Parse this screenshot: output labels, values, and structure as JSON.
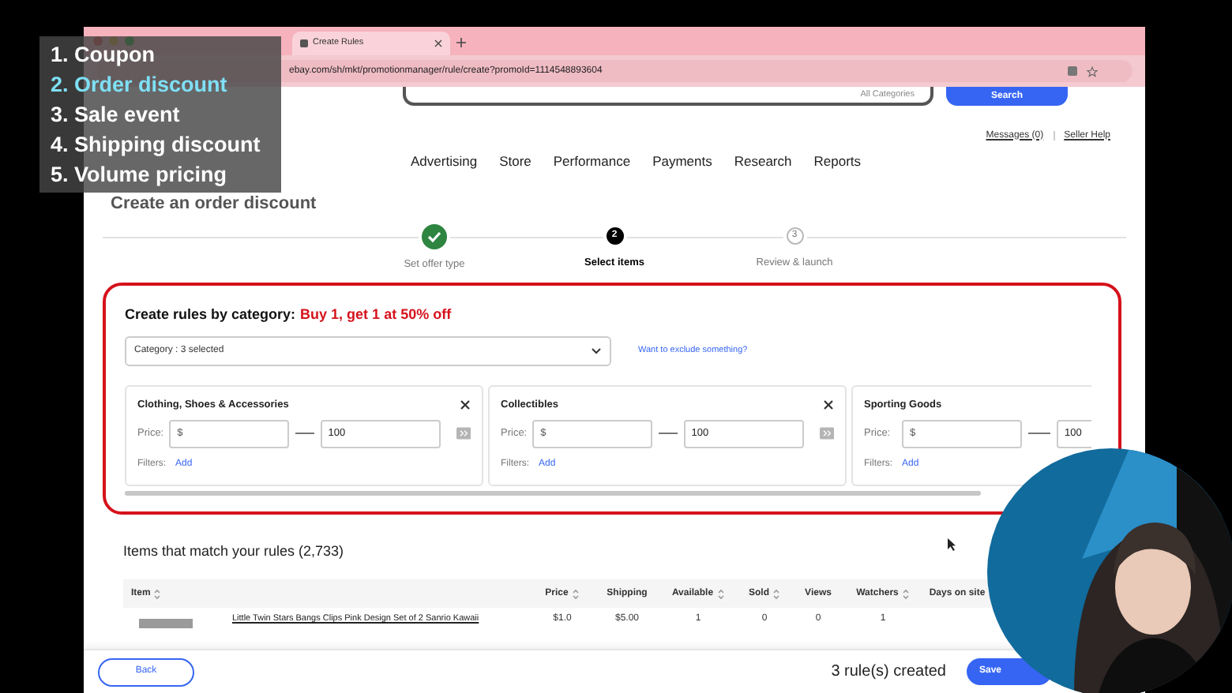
{
  "overlay_list": [
    {
      "label": "1. Coupon",
      "selected": false
    },
    {
      "label": "2. Order discount",
      "selected": true
    },
    {
      "label": "3. Sale event",
      "selected": false
    },
    {
      "label": "4. Shipping discount",
      "selected": false
    },
    {
      "label": "5. Volume pricing",
      "selected": false
    }
  ],
  "browser": {
    "tab_title": "Create Rules",
    "url": "ebay.com/sh/mkt/promotionmanager/rule/create?promoId=1114548893604"
  },
  "header": {
    "category_select": "All Categories",
    "search_button": "Search",
    "links": [
      "Messages (0)",
      "Seller Help"
    ],
    "nav": [
      "Advertising",
      "Store",
      "Performance",
      "Payments",
      "Research",
      "Reports"
    ]
  },
  "page_title": "Create an order discount",
  "steps": [
    {
      "label": "Set offer type",
      "completed": true,
      "selected": false
    },
    {
      "number": "2",
      "label": "Select items",
      "completed": false,
      "selected": true
    },
    {
      "number": "3",
      "label": "Review & launch",
      "completed": false,
      "selected": false
    }
  ],
  "rules": {
    "title": "Create rules by category:",
    "offer": "Buy 1, get 1 at 50% off",
    "category_dropdown": "Category : 3 selected",
    "exclude_link": "Want to exclude something?",
    "cards": [
      {
        "name": "Clothing, Shoes & Accessories",
        "price_label": "Price:",
        "min_placeholder": "$",
        "max_value": "100",
        "filters_label": "Filters:",
        "filters_link": "Add"
      },
      {
        "name": "Collectibles",
        "price_label": "Price:",
        "min_placeholder": "$",
        "max_value": "100",
        "filters_label": "Filters:",
        "filters_link": "Add"
      },
      {
        "name": "Sporting Goods",
        "price_label": "Price:",
        "min_placeholder": "$",
        "max_value": "100",
        "filters_label": "Filters:",
        "filters_link": "Add"
      }
    ]
  },
  "items": {
    "heading": "Items that match your rules (2,733)",
    "columns": [
      {
        "label": "Item",
        "sortable": true
      },
      {
        "label": "Price",
        "sortable": true
      },
      {
        "label": "Shipping",
        "sortable": false
      },
      {
        "label": "Available",
        "sortable": true
      },
      {
        "label": "Sold",
        "sortable": true
      },
      {
        "label": "Views",
        "sortable": false
      },
      {
        "label": "Watchers",
        "sortable": true
      },
      {
        "label": "Days on site",
        "sortable": false
      }
    ],
    "rows": [
      {
        "cells": [
          "Little Twin Stars Bangs Clips Pink Design Set of 2 Sanrio Kawaii",
          "$1.0",
          "$5.00",
          "1",
          "0",
          "0",
          "1"
        ]
      }
    ]
  },
  "footer": {
    "back": "Back",
    "status": "3 rule(s) created",
    "save": "Save"
  }
}
